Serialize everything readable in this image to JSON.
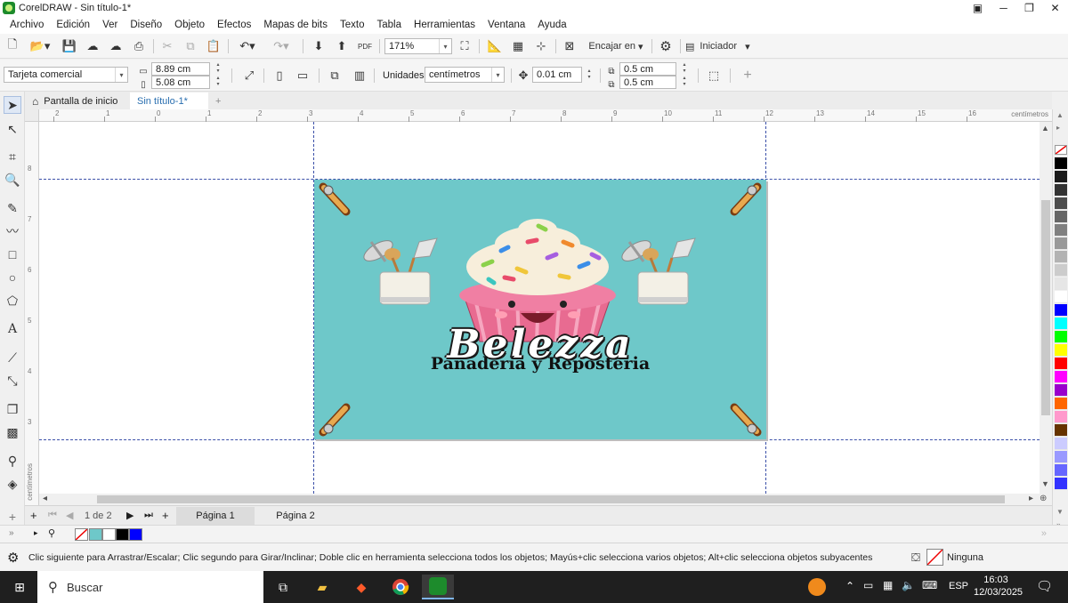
{
  "window": {
    "title": "CorelDRAW - Sin título-1*"
  },
  "menu": [
    "Archivo",
    "Edición",
    "Ver",
    "Diseño",
    "Objeto",
    "Efectos",
    "Mapas de bits",
    "Texto",
    "Tabla",
    "Herramientas",
    "Ventana",
    "Ayuda"
  ],
  "toolbar": {
    "zoom": "171%",
    "fit_label": "Encajar en",
    "launcher_label": "Iniciador"
  },
  "property_bar": {
    "page_preset": "Tarjeta comercial",
    "width": "8.89 cm",
    "height": "5.08 cm",
    "units_label": "Unidades:",
    "units_value": "centímetros",
    "nudge": "0.01 cm",
    "dup_x": "0.5 cm",
    "dup_y": "0.5 cm"
  },
  "tabs": {
    "home": "Pantalla de inicio",
    "document": "Sin título-1*"
  },
  "ruler": {
    "h_labels": [
      "2",
      "1",
      "0",
      "1",
      "2",
      "3",
      "4",
      "5",
      "6",
      "7",
      "8",
      "9",
      "10",
      "11",
      "12",
      "13",
      "14",
      "15",
      "16"
    ],
    "h_unit": "centímetros",
    "v_labels": [
      "8",
      "7",
      "6",
      "5",
      "4",
      "3"
    ],
    "v_unit": "centímetros"
  },
  "card": {
    "brand": "Belezza",
    "subtitle": "Panadería y Reposteria"
  },
  "pages": {
    "counter": "1 de 2",
    "tab1": "Página 1",
    "tab2": "Página 2"
  },
  "status": {
    "hint": "Clic siguiente para Arrastrar/Escalar; Clic segundo para Girar/Inclinar; Doble clic en herramienta selecciona todos los objetos; Mayús+clic selecciona varios objetos; Alt+clic selecciona objetos subyacentes",
    "fill": "Ninguna"
  },
  "taskbar": {
    "search": "Buscar",
    "lang": "ESP",
    "time": "16:03",
    "date": "12/03/2025"
  },
  "colors": {
    "palette": [
      "#000000",
      "#1a1a1a",
      "#333333",
      "#4d4d4d",
      "#666666",
      "#808080",
      "#999999",
      "#b3b3b3",
      "#cccccc",
      "#e6e6e6",
      "#ffffff",
      "#0000ff",
      "#00ffff",
      "#00ff00",
      "#ffff00",
      "#ff0000",
      "#ff00ff",
      "#9900cc",
      "#ff6600",
      "#ff99cc",
      "#663300",
      "#ccccff",
      "#9999ff",
      "#6666ff",
      "#3333ff"
    ],
    "doc_palette": [
      "#6ec8c9",
      "#ffffff",
      "#000000",
      "#0000ff"
    ],
    "card_bg": "#6ec8c9"
  }
}
